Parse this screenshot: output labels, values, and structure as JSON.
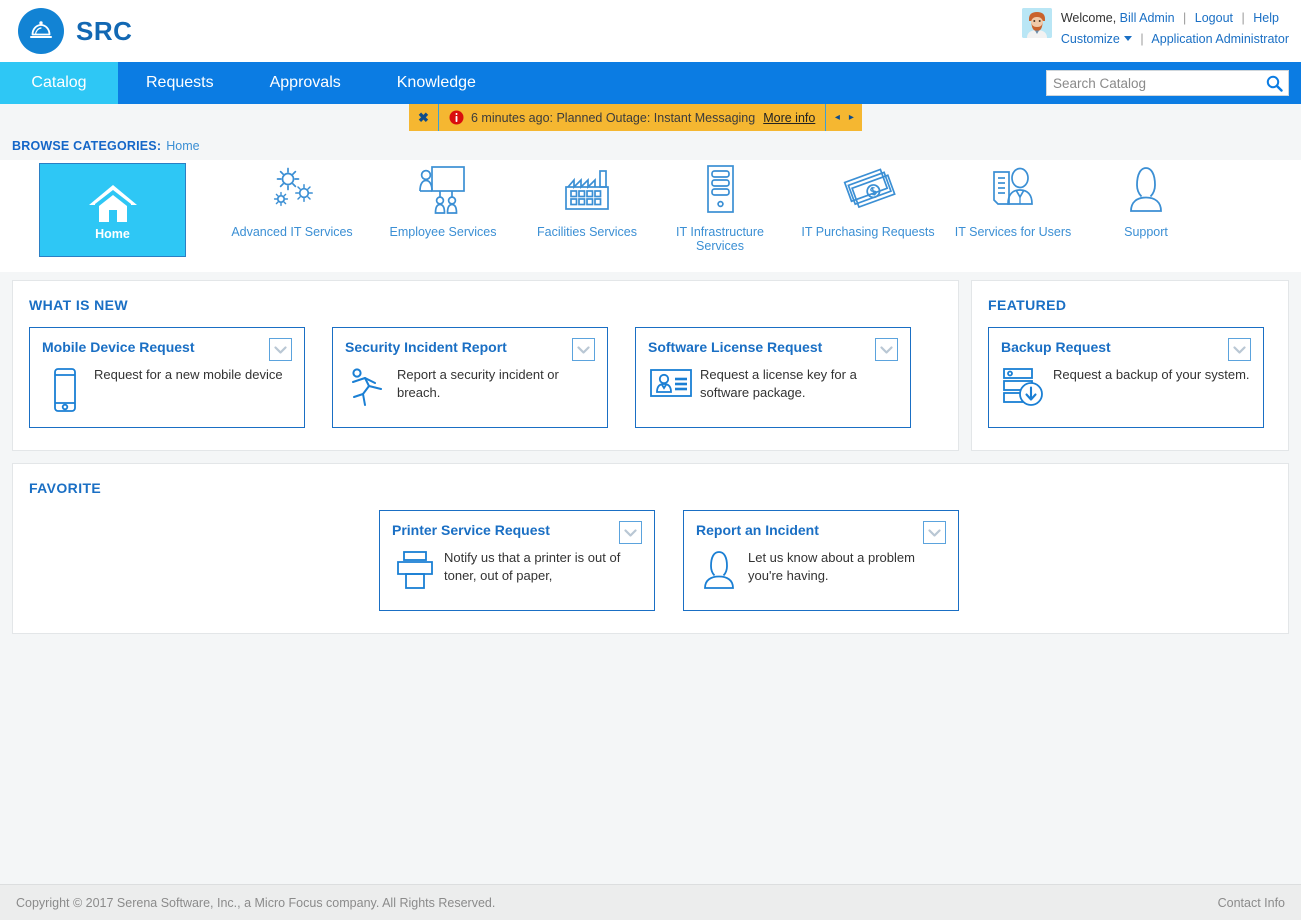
{
  "brand": {
    "name": "SRC",
    "logo_icon": "service-bell-icon",
    "color": "#1283d4"
  },
  "header": {
    "welcome_prefix": "Welcome,",
    "user_name": "Bill Admin",
    "logout_label": "Logout",
    "help_label": "Help",
    "customize_label": "Customize",
    "role_label": "Application Administrator",
    "separator": "|",
    "avatar_icon": "user-avatar-icon"
  },
  "nav": {
    "tabs": [
      {
        "label": "Catalog",
        "active": true
      },
      {
        "label": "Requests",
        "active": false
      },
      {
        "label": "Approvals",
        "active": false
      },
      {
        "label": "Knowledge",
        "active": false
      }
    ],
    "active_color": "#2ec7f5",
    "bar_color": "#0b7ce3"
  },
  "search": {
    "placeholder": "Search Catalog",
    "value": "",
    "icon": "search-icon"
  },
  "notification": {
    "close_label": "✖",
    "icon": "info-alert-icon",
    "text": "6 minutes ago: Planned Outage: Instant Messaging",
    "link_label": "More info",
    "prev_label": "◂",
    "next_label": "▸",
    "background": "#f5b731"
  },
  "breadcrumb": {
    "label": "BROWSE CATEGORIES:",
    "current": "Home"
  },
  "categories": [
    {
      "label": "Home",
      "icon": "home-icon",
      "active": true
    },
    {
      "label": "Advanced IT Services",
      "icon": "gears-icon",
      "active": false
    },
    {
      "label": "Employee Services",
      "icon": "presentation-people-icon",
      "active": false
    },
    {
      "label": "Facilities Services",
      "icon": "factory-icon",
      "active": false
    },
    {
      "label": "IT Infrastructure Services",
      "icon": "server-tower-icon",
      "active": false
    },
    {
      "label": "IT Purchasing Requests",
      "icon": "money-bills-icon",
      "active": false
    },
    {
      "label": "IT Services for Users",
      "icon": "user-document-icon",
      "active": false
    },
    {
      "label": "Support",
      "icon": "headset-person-icon",
      "active": false
    }
  ],
  "panels": {
    "what_is_new": {
      "title": "WHAT IS NEW",
      "cards": [
        {
          "title": "Mobile Device Request",
          "description": "Request for a new mobile device",
          "icon": "mobile-phone-icon",
          "menu_icon": "chevron-down-icon"
        },
        {
          "title": "Security Incident Report",
          "description": "Report a security incident or breach.",
          "icon": "running-person-icon",
          "menu_icon": "chevron-down-icon"
        },
        {
          "title": "Software License Request",
          "description": "Request a license key for a software package.",
          "icon": "id-badge-icon",
          "menu_icon": "chevron-down-icon"
        }
      ]
    },
    "featured": {
      "title": "FEATURED",
      "cards": [
        {
          "title": "Backup Request",
          "description": "Request a backup of your system.",
          "icon": "server-backup-icon",
          "menu_icon": "chevron-down-icon"
        }
      ]
    },
    "favorite": {
      "title": "FAVORITE",
      "cards": [
        {
          "title": "Printer Service Request",
          "description": "Notify us that a printer is out of toner, out of paper,",
          "icon": "printer-icon",
          "menu_icon": "chevron-down-icon"
        },
        {
          "title": "Report an Incident",
          "description": "Let us know about a problem you're having.",
          "icon": "person-bust-icon",
          "menu_icon": "chevron-down-icon"
        }
      ]
    }
  },
  "footer": {
    "copyright": "Copyright © 2017 Serena Software, Inc., a Micro Focus company. All Rights Reserved.",
    "contact_label": "Contact Info"
  }
}
